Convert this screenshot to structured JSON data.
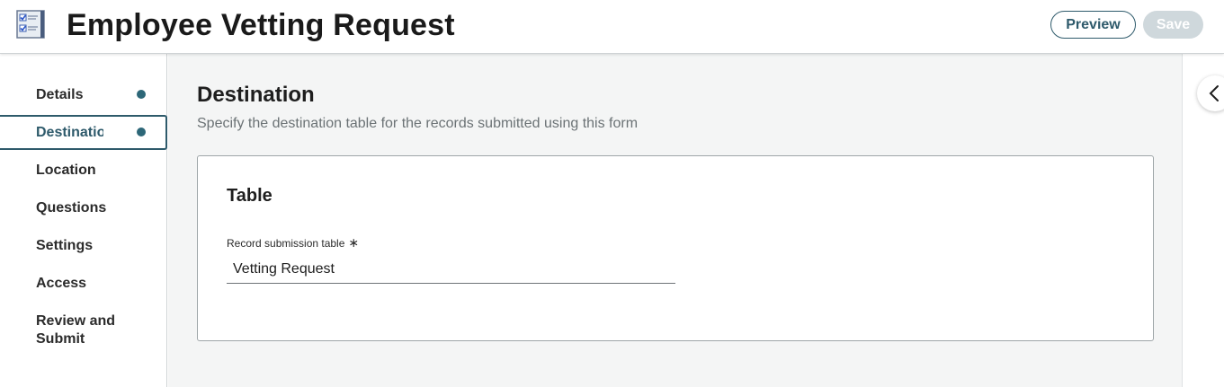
{
  "header": {
    "title": "Employee Vetting Request",
    "app_icon": "checklist-form-icon",
    "preview_label": "Preview",
    "save_label": "Save"
  },
  "sidebar": {
    "items": [
      {
        "label": "Details",
        "has_dot": true,
        "active": false
      },
      {
        "label": "Destination",
        "has_dot": true,
        "active": true
      },
      {
        "label": "Location",
        "has_dot": false,
        "active": false
      },
      {
        "label": "Questions",
        "has_dot": false,
        "active": false
      },
      {
        "label": "Settings",
        "has_dot": false,
        "active": false
      },
      {
        "label": "Access",
        "has_dot": false,
        "active": false
      },
      {
        "label": "Review and Submit",
        "has_dot": false,
        "active": false
      }
    ],
    "dot_color": "#2d6778"
  },
  "main": {
    "section_title": "Destination",
    "section_description": "Specify the destination table for the records submitted using this form",
    "card": {
      "title": "Table",
      "field_label": "Record submission table",
      "required_marker": "∗",
      "field_value": "Vetting Request"
    }
  },
  "right_panel": {
    "collapse_icon": "chevron-left-icon"
  },
  "colors": {
    "accent": "#2e5a6b",
    "save_disabled": "#cfd8dc",
    "main_bg": "#f4f5f5"
  }
}
